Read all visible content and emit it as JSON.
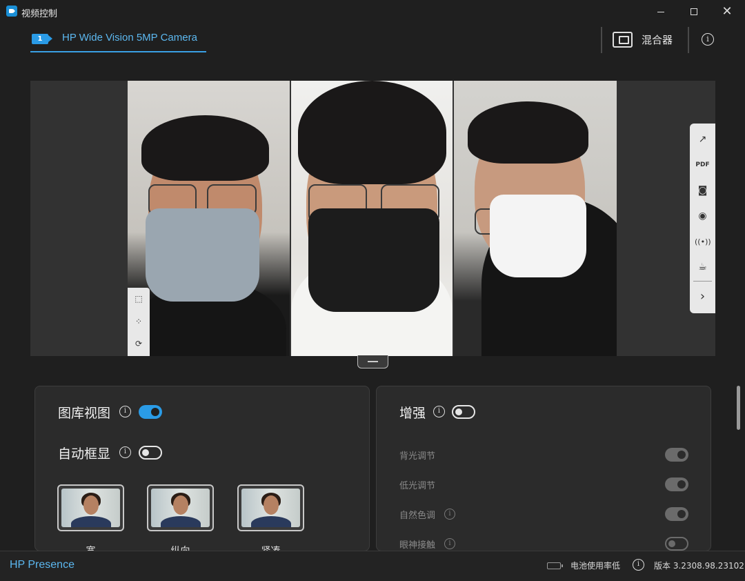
{
  "window": {
    "title": "视频控制",
    "minimize_icon": "minimize-icon",
    "maximize_icon": "maximize-icon",
    "close_icon": "close-icon"
  },
  "header": {
    "camera_tab": {
      "number": "1",
      "label": "HP Wide Vision 5MP Camera"
    },
    "mixer_label": "混合器",
    "info_icon": "info-icon"
  },
  "preview": {
    "left_toolbar": [
      "auto-frame-icon",
      "framing-points-icon",
      "rotate-icon"
    ],
    "right_toolbar": [
      "pop-out-icon",
      "pdf-icon",
      "camera-snapshot-icon",
      "record-icon",
      "broadcast-icon",
      "coffee-break-icon",
      "expand-arrow-icon"
    ]
  },
  "left_panel": {
    "gallery_view": {
      "label": "图库视图",
      "enabled": true
    },
    "auto_framing": {
      "label": "自动框显",
      "enabled": false
    },
    "framing_modes": [
      {
        "label": "宽"
      },
      {
        "label": "纵向"
      },
      {
        "label": "紧凑"
      }
    ]
  },
  "right_panel": {
    "enhance": {
      "label": "增强",
      "enabled": false
    },
    "options": [
      {
        "label": "背光调节",
        "enabled": true,
        "has_info": false
      },
      {
        "label": "低光调节",
        "enabled": true,
        "has_info": false
      },
      {
        "label": "自然色调",
        "enabled": true,
        "has_info": true
      },
      {
        "label": "眼神接触",
        "enabled": false,
        "has_info": true
      }
    ]
  },
  "footer": {
    "brand": "HP Presence",
    "battery_text": "电池使用率低",
    "version": "版本 3.2308.98.23102"
  },
  "colors": {
    "accent": "#2a9be6",
    "background": "#1f1f1f",
    "panel": "#2b2b2b"
  }
}
